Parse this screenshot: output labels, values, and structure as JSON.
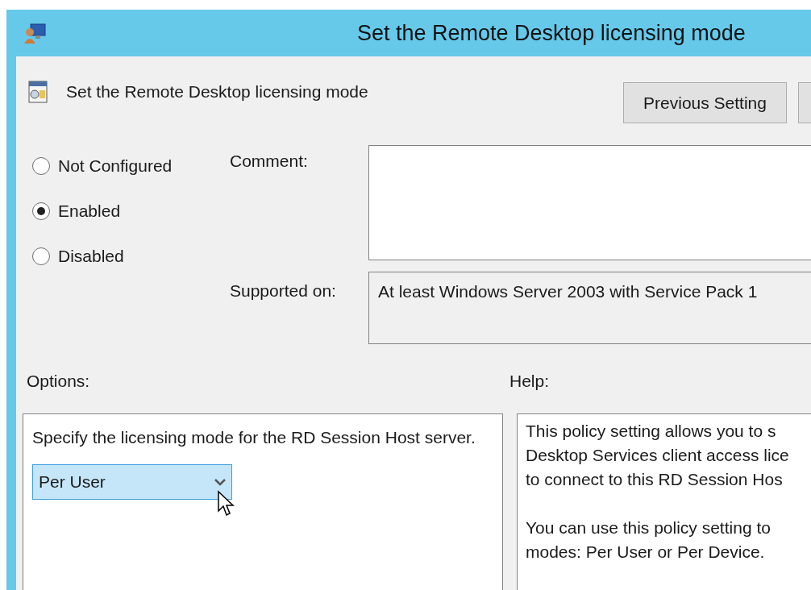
{
  "window": {
    "title": "Set the Remote Desktop licensing mode"
  },
  "header": {
    "title": "Set the Remote Desktop licensing mode",
    "buttons": [
      "Previous Setting"
    ]
  },
  "states": [
    {
      "label": "Not Configured",
      "selected": false
    },
    {
      "label": "Enabled",
      "selected": true
    },
    {
      "label": "Disabled",
      "selected": false
    }
  ],
  "comment": {
    "label": "Comment:"
  },
  "supported_on": {
    "label": "Supported on:",
    "value": "At least Windows Server 2003 with Service Pack 1"
  },
  "options": {
    "label": "Options:",
    "description": "Specify the licensing mode for the RD Session Host server.",
    "dropdown": {
      "value": "Per User",
      "hovered": true
    }
  },
  "help": {
    "label": "Help:",
    "paragraphs": [
      "This policy setting allows you to s\nDesktop Services client access lice\nto connect to this RD Session Hos",
      "You can use this policy setting to\nmodes: Per User or Per Device."
    ]
  }
}
